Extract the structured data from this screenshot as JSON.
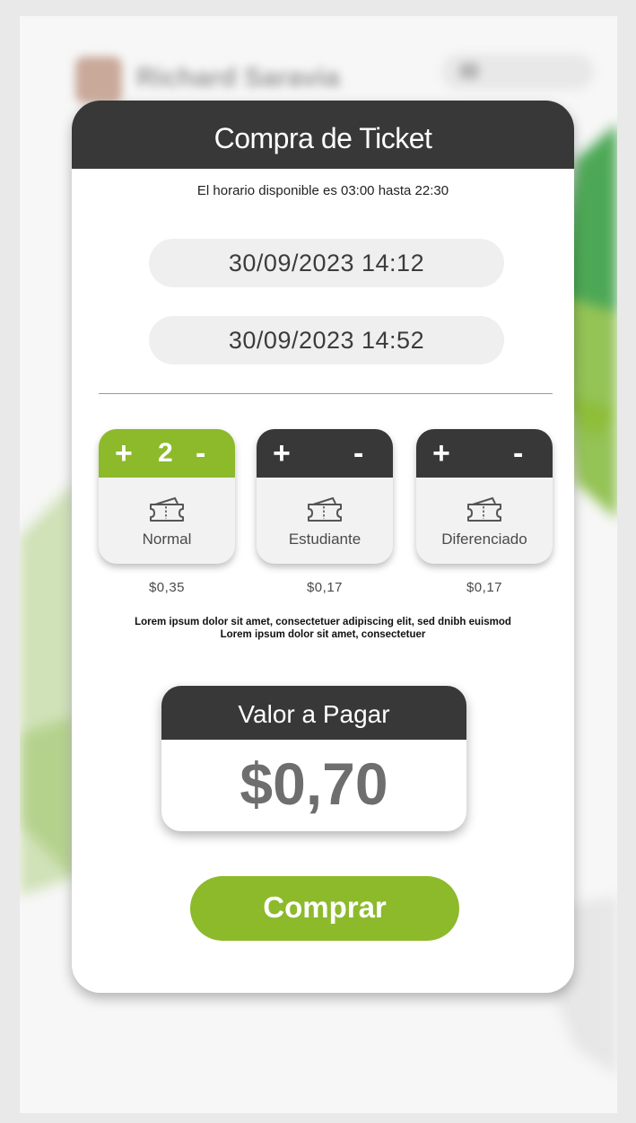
{
  "background": {
    "user_name": "Richard Saravia"
  },
  "modal": {
    "title": "Compra de Ticket",
    "schedule_text": "El horario disponible es 03:00 hasta 22:30",
    "start_datetime": "30/09/2023  14:12",
    "end_datetime": "30/09/2023  14:52"
  },
  "tickets": [
    {
      "label": "Normal",
      "price": "$0,35",
      "count": "2",
      "plus": "+",
      "minus": "-",
      "active": true
    },
    {
      "label": "Estudiante",
      "price": "$0,17",
      "count": "",
      "plus": "+",
      "minus": "-",
      "active": false
    },
    {
      "label": "Diferenciado",
      "price": "$0,17",
      "count": "",
      "plus": "+",
      "minus": "-",
      "active": false
    }
  ],
  "notice": {
    "line1": "Lorem ipsum dolor sit amet, consectetuer adipiscing elit, sed dnibh euismod",
    "line2": "Lorem ipsum dolor sit amet, consectetuer"
  },
  "total": {
    "label": "Valor a Pagar",
    "value": "$0,70"
  },
  "buy_button": {
    "label": "Comprar"
  },
  "colors": {
    "accent": "#8cba2b",
    "dark": "#383838"
  }
}
